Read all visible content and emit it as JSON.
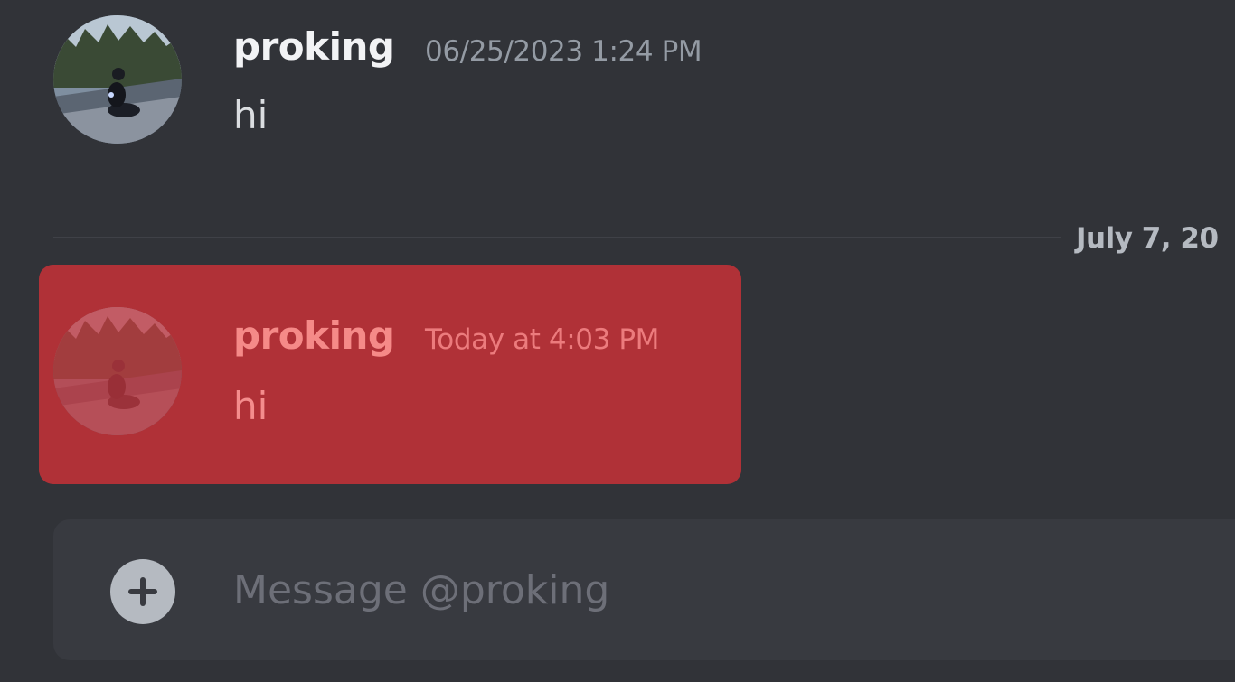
{
  "conversation": {
    "messages": [
      {
        "author": "proking",
        "timestamp": "06/25/2023 1:24 PM",
        "content": "hi",
        "avatar_icon": "user-avatar-motorcycle-rider"
      },
      {
        "author": "proking",
        "timestamp": "Today at 4:03 PM",
        "content": "hi",
        "avatar_icon": "user-avatar-motorcycle-rider",
        "highlight_color": "#b03137"
      }
    ],
    "date_divider": "July 7, 20"
  },
  "composer": {
    "placeholder": "Message @proking",
    "add_icon": "plus-circle-icon"
  },
  "colors": {
    "background": "#313338",
    "composer_bg": "#383a40",
    "highlight": "#b03137"
  }
}
